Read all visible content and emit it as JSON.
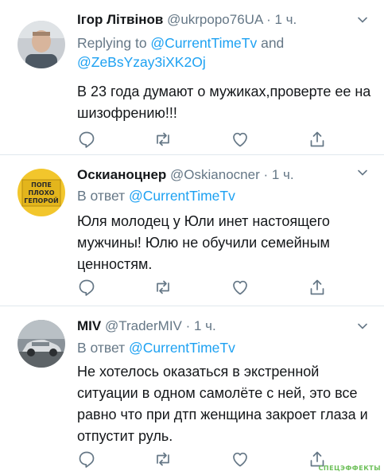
{
  "tweets": [
    {
      "name": "Ігор Літвінов",
      "handle": "@ukrpopo76UA",
      "time": "· 1 ч.",
      "reply_prefix": "Replying to ",
      "reply_to_1": "@CurrentTimeTv",
      "reply_and": " and",
      "reply_to_2": "@ZeBsYzay3iXK2Oj",
      "text": "В 23 года думают о мужиках,проверте ее на шизофрению!!!"
    },
    {
      "name": "Оскианоцнер",
      "handle": "@Oskianocner",
      "time": "· 1 ч.",
      "reply_prefix": "В ответ ",
      "reply_to_1": "@CurrentTimeTv",
      "text": "Юля молодец у Юли инет настоящего мужчины! Юлю не обучили семейным ценностям.",
      "avatar_sign": [
        "ПОПЕ",
        "ПЛОХО",
        "ГЕПОРОЙ"
      ]
    },
    {
      "name": "MIV",
      "handle": "@TraderMIV",
      "time": "· 1 ч.",
      "reply_prefix": "В ответ ",
      "reply_to_1": "@CurrentTimeTv",
      "text": "Не хотелось оказаться в экстренной ситуации в одном самолёте с ней, это все равно что при дтп женщина закроет глаза и отпустит руль."
    }
  ],
  "watermark": "СПЕЦЭФФЕКТЫ",
  "icons": [
    "reply-icon",
    "retweet-icon",
    "like-icon",
    "share-icon",
    "chevron-down-icon"
  ],
  "colors": {
    "link": "#1da1f2",
    "muted": "#657786",
    "text": "#14171a",
    "border": "#e1e8ed"
  }
}
